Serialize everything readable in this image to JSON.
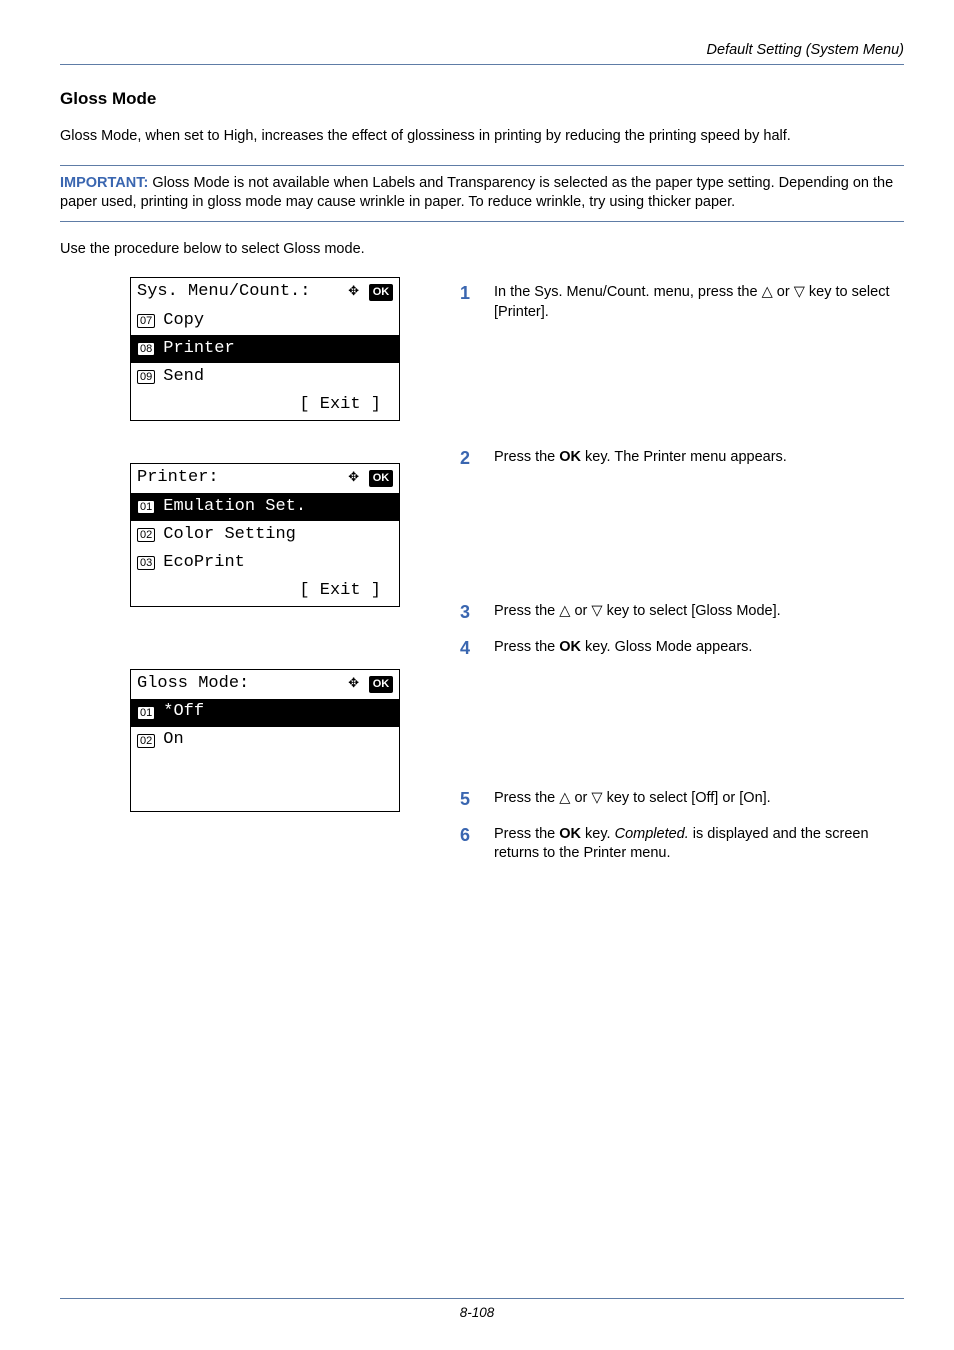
{
  "header": {
    "right_title": "Default Setting (System Menu)"
  },
  "section": {
    "title": "Gloss Mode"
  },
  "body": {
    "intro": "Gloss Mode, when set to High, increases the effect of glossiness in printing by reducing the printing speed by half.",
    "important_label": "IMPORTANT:",
    "important_text": " Gloss Mode is not available when Labels and Transparency is selected as the paper type setting. Depending on the paper used, printing in gloss mode may cause wrinkle in paper. To reduce wrinkle, try using thicker paper.",
    "procedure_intro": "Use the procedure below to select Gloss mode."
  },
  "lcds": {
    "screen1": {
      "title": "Sys. Menu/Count.:",
      "items": [
        {
          "num": "07",
          "label": "Copy"
        },
        {
          "num": "08",
          "label": "Printer"
        },
        {
          "num": "09",
          "label": "Send"
        }
      ],
      "exit": "[  Exit  ]"
    },
    "screen2": {
      "title": "Printer:",
      "items": [
        {
          "num": "01",
          "label": "Emulation Set."
        },
        {
          "num": "02",
          "label": "Color Setting"
        },
        {
          "num": "03",
          "label": "EcoPrint"
        }
      ],
      "exit": "[  Exit  ]"
    },
    "screen3": {
      "title": "Gloss Mode:",
      "items": [
        {
          "num": "01",
          "label": "*Off"
        },
        {
          "num": "02",
          "label": "On"
        }
      ]
    }
  },
  "steps": {
    "s1_a": "In the Sys. Menu/Count. menu, press the ",
    "s1_b": " or ",
    "s1_c": " key to select [Printer].",
    "s2": "Press the ",
    "s2_bold": "OK",
    "s2_end": " key. The Printer menu appears.",
    "s3_a": "Press the ",
    "s3_b": " or ",
    "s3_c": " key to select [Gloss Mode].",
    "s4": "Press the ",
    "s4_bold": "OK",
    "s4_end": " key. Gloss Mode appears.",
    "s5_a": "Press the ",
    "s5_b": " or ",
    "s5_c": " key to select [Off] or [On].",
    "s6": "Press the ",
    "s6_bold": "OK",
    "s6_mid": " key. ",
    "s6_italic": "Completed.",
    "s6_end": " is displayed and the screen returns to the Printer menu."
  },
  "icons": {
    "ok_label": "OK"
  },
  "footer": {
    "page": "8-108"
  }
}
